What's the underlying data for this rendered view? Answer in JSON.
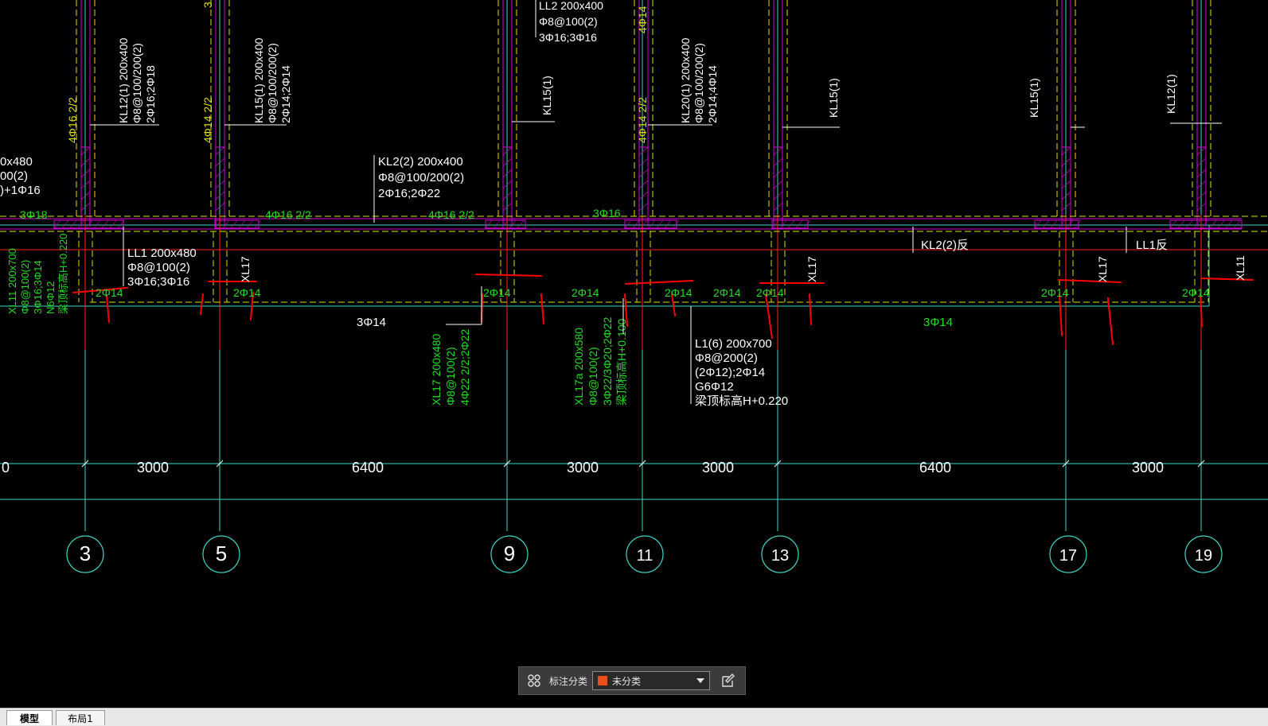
{
  "colors": {
    "grid": "#3fd7c8",
    "beam": "#e0e000",
    "wall": "#d400d4",
    "label_white": "#ffffff",
    "label_green": "#22dd22",
    "markup": "#ff0000",
    "dim": "#ffffff"
  },
  "grid_axes": [
    {
      "id": "axis-3",
      "label": "3"
    },
    {
      "id": "axis-5",
      "label": "5"
    },
    {
      "id": "axis-9",
      "label": "9"
    },
    {
      "id": "axis-11",
      "label": "11"
    },
    {
      "id": "axis-13",
      "label": "13"
    },
    {
      "id": "axis-17",
      "label": "17"
    },
    {
      "id": "axis-19",
      "label": "19"
    }
  ],
  "dimensions": [
    "0",
    "3000",
    "6400",
    "3000",
    "3000",
    "6400",
    "3000"
  ],
  "beam_labels": {
    "kl12_top": [
      "KL12(1) 200x400",
      "Φ8@100/200(2)",
      "2Φ16;2Φ18"
    ],
    "kl15_top": [
      "KL15(1) 200x400",
      "Φ8@100/200(2)",
      "2Φ14;2Φ14"
    ],
    "kl20_top": [
      "KL20(1) 200x400",
      "Φ8@100/200(2)",
      "2Φ14;4Φ14"
    ],
    "kl2_mid": [
      "KL2(2) 200x400",
      "Φ8@100/200(2)",
      "2Φ16;2Φ22"
    ],
    "top_partial": [
      "LL2 200x400",
      "Φ8@100(2)",
      "3Φ16;3Φ16"
    ],
    "left_partial": [
      "0x480",
      "00(2)",
      ")+1Φ16"
    ],
    "ll1": [
      "LL1 200x480",
      "Φ8@100(2)",
      "3Φ16;3Φ16"
    ],
    "xl11_left": [
      "XL11 200x700",
      "Φ8@100(2)",
      "3Φ16;3Φ14",
      "N6Φ12",
      "梁顶标高H+0.220"
    ],
    "xl17": [
      "XL17 200x480",
      "Φ8@100(2)",
      "4Φ22 2/2;2Φ22"
    ],
    "xl17a": [
      "XL17a 200x580",
      "Φ8@100(2)",
      "3Φ22/3Φ20;2Φ22",
      "梁顶标高H+0.100"
    ],
    "l1": [
      "L1(6) 200x700",
      "Φ8@200(2)",
      "(2Φ12);2Φ14",
      "G6Φ12",
      "梁顶标高H+0.220"
    ],
    "kl15_1": "KL15(1)",
    "kl15_2": "KL15(1)",
    "kl15_3": "KL15(1)",
    "kl12_right": "KL12(1)",
    "kl2_rev": "KL2(2)反",
    "ll1_rev": "LL1反",
    "xl17_a": "XL17",
    "xl17_b": "XL17",
    "xl17_c": "XL17",
    "xl11_right": "XL11",
    "col_4phi16": "4Φ16 2/2",
    "col_4phi14": "4Φ14 2/2",
    "col_4phi14_b": "4Φ14 2/2",
    "col_4phi14_top": "4Φ14",
    "col_3_top": "3"
  },
  "rebar_labels": {
    "r_3phi18": "3Φ18",
    "r_4phi16_a": "4Φ16 2/2",
    "r_4phi16_b": "4Φ16 2/2",
    "r_3phi16": "3Φ16",
    "r_2phi14": "2Φ14",
    "r_3phi14_white": "3Φ14",
    "r_3phi14_green": "3Φ14"
  },
  "annotation_bar": {
    "label": "标注分类",
    "selected": "未分类",
    "swatch_color": "#e8501c"
  },
  "tabs": {
    "model": "模型",
    "layout1": "布局1"
  }
}
